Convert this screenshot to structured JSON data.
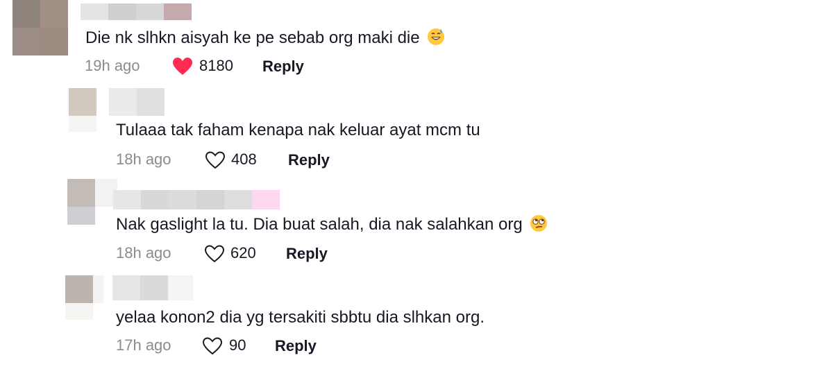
{
  "comments": [
    {
      "text": "Die nk slhkn aisyah ke pe sebab org maki die",
      "emoji": "grinning-sweat-emoji",
      "time": "19h ago",
      "likes": "8180",
      "liked": true,
      "reply": "Reply"
    },
    {
      "text": "Tulaaa tak faham kenapa nak keluar ayat mcm tu",
      "time": "18h ago",
      "likes": "408",
      "liked": false,
      "reply": "Reply"
    },
    {
      "text": "Nak gaslight la tu. Dia buat salah, dia nak salahkan org",
      "emoji": "rolling-eyes-emoji",
      "time": "18h ago",
      "likes": "620",
      "liked": false,
      "reply": "Reply"
    },
    {
      "text": "yelaa konon2 dia yg tersakiti sbbtu dia slhkan org.",
      "time": "17h ago",
      "likes": "90",
      "liked": false,
      "reply": "Reply"
    }
  ],
  "colors": {
    "liked_heart": "#fe2c55",
    "muted_text": "#8a8b91",
    "primary_text": "#161823"
  }
}
